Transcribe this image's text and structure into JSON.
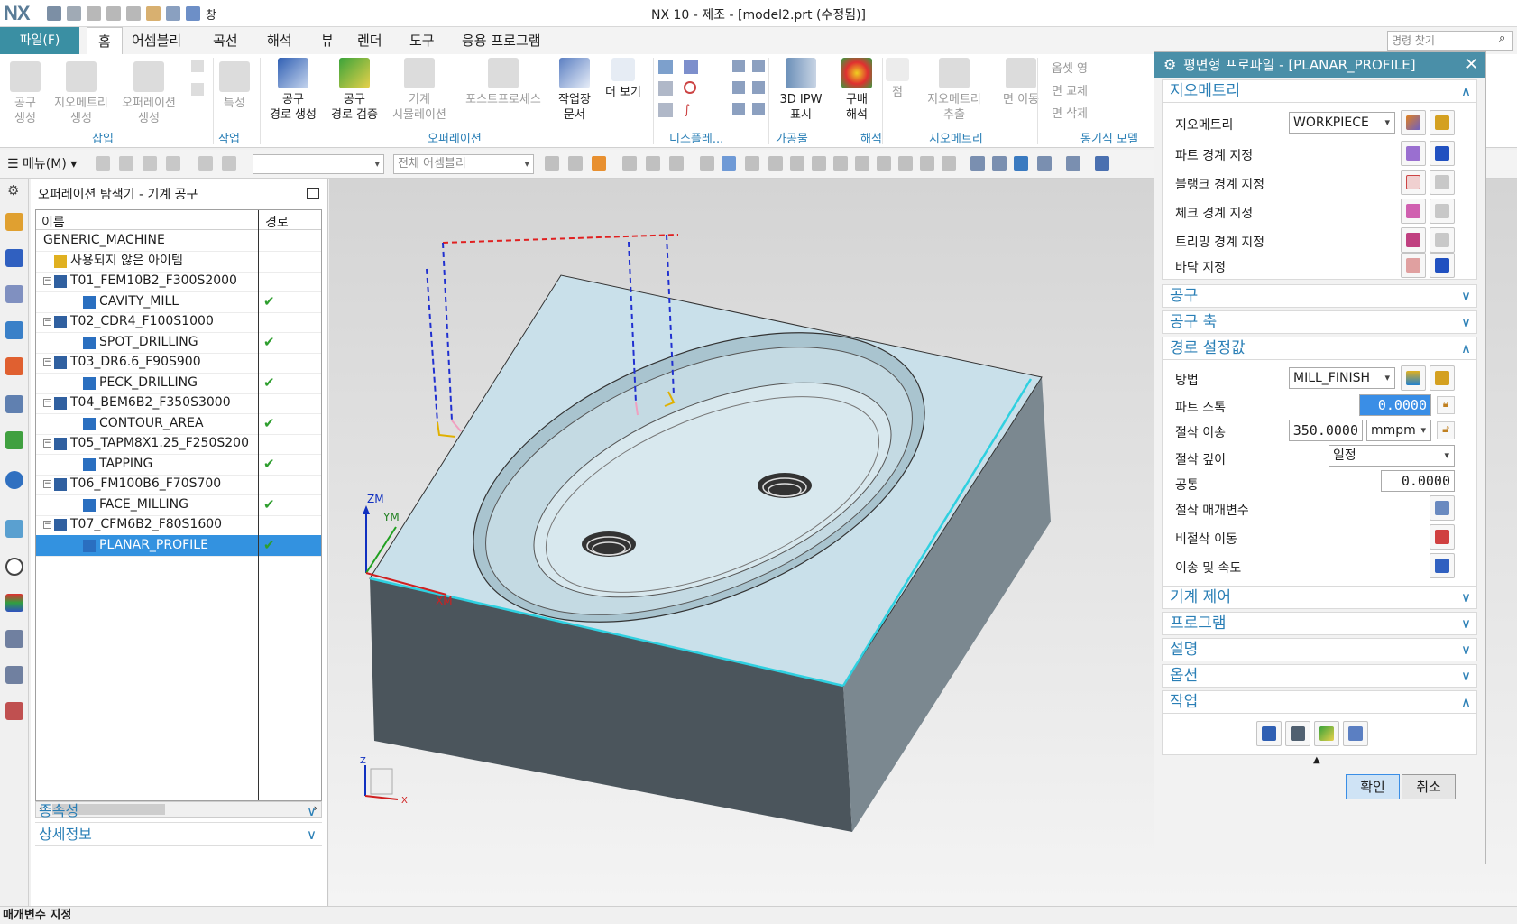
{
  "app": {
    "logo": "NX",
    "title": "NX 10 - 제조 - [model2.prt (수정됨)]",
    "window_menu": "창"
  },
  "menubar": {
    "file": "파일(F)",
    "tabs": [
      "홈",
      "어셈블리",
      "곡선",
      "해석",
      "뷰",
      "렌더",
      "도구",
      "응용 프로그램"
    ],
    "active_tab": "홈",
    "search_placeholder": "명령 찾기"
  },
  "ribbon": {
    "buttons": [
      {
        "label": "공구\n생성",
        "disabled": true
      },
      {
        "label": "지오메트리\n생성",
        "disabled": true
      },
      {
        "label": "오퍼레이션\n생성",
        "disabled": true
      },
      {
        "label": "특성",
        "disabled": true
      },
      {
        "label": "공구\n경로 생성",
        "disabled": false
      },
      {
        "label": "공구\n경로 검증",
        "disabled": false
      },
      {
        "label": "기계\n시뮬레이션",
        "disabled": true
      },
      {
        "label": "포스트프로세스",
        "disabled": true
      },
      {
        "label": "작업장\n문서",
        "disabled": false
      },
      {
        "label": "더 보기",
        "disabled": false
      },
      {
        "label": "3D IPW\n표시",
        "disabled": false
      },
      {
        "label": "구배\n해석",
        "disabled": false
      },
      {
        "label": "점",
        "disabled": true
      },
      {
        "label": "지오메트리\n추출",
        "disabled": true
      },
      {
        "label": "면 이동",
        "disabled": true
      }
    ],
    "small_items": [
      "옵셋 영",
      "면 교체",
      "면 삭제"
    ],
    "groups": [
      "삽입",
      "작업",
      "오퍼레이션",
      "디스플레...",
      "가공물",
      "해석",
      "지오메트리",
      "동기식 모델"
    ]
  },
  "toolbar2": {
    "menu": "메뉴(M)",
    "filter_placeholder": "",
    "assembly_scope": "전체 어셈블리"
  },
  "navigator": {
    "title": "오퍼레이션 탐색기 - 기계 공구",
    "columns": [
      "이름",
      "경로"
    ],
    "rows": [
      {
        "name": "GENERIC_MACHINE",
        "level": 0,
        "type": "machine",
        "check": ""
      },
      {
        "name": "사용되지 않은 아이템",
        "level": 1,
        "type": "folder",
        "check": ""
      },
      {
        "name": "T01_FEM10B2_F300S2000",
        "level": 1,
        "type": "tool",
        "check": ""
      },
      {
        "name": "CAVITY_MILL",
        "level": 2,
        "type": "op",
        "check": "✔"
      },
      {
        "name": "T02_CDR4_F100S1000",
        "level": 1,
        "type": "tool",
        "check": ""
      },
      {
        "name": "SPOT_DRILLING",
        "level": 2,
        "type": "op",
        "check": "✔"
      },
      {
        "name": "T03_DR6.6_F90S900",
        "level": 1,
        "type": "tool",
        "check": ""
      },
      {
        "name": "PECK_DRILLING",
        "level": 2,
        "type": "op",
        "check": "✔"
      },
      {
        "name": "T04_BEM6B2_F350S3000",
        "level": 1,
        "type": "tool",
        "check": ""
      },
      {
        "name": "CONTOUR_AREA",
        "level": 2,
        "type": "op",
        "check": "✔"
      },
      {
        "name": "T05_TAPM8X1.25_F250S200",
        "level": 1,
        "type": "tool",
        "check": ""
      },
      {
        "name": "TAPPING",
        "level": 2,
        "type": "op",
        "check": "✔"
      },
      {
        "name": "T06_FM100B6_F70S700",
        "level": 1,
        "type": "tool",
        "check": ""
      },
      {
        "name": "FACE_MILLING",
        "level": 2,
        "type": "op",
        "check": "✔"
      },
      {
        "name": "T07_CFM6B2_F80S1600",
        "level": 1,
        "type": "tool",
        "check": ""
      },
      {
        "name": "PLANAR_PROFILE",
        "level": 2,
        "type": "op",
        "check": "✔",
        "selected": true
      }
    ],
    "bottom_sections": [
      "종속성",
      "상세정보"
    ]
  },
  "viewport": {
    "axis_labels": [
      "ZM",
      "YM",
      "XM"
    ],
    "triad": [
      "Z",
      "X"
    ]
  },
  "dialog": {
    "title": "평면형 프로파일 - [PLANAR_PROFILE]",
    "geometry": {
      "header": "지오메트리",
      "label": "지오메트리",
      "value": "WORKPIECE",
      "items": [
        "파트 경계 지정",
        "블랭크 경계 지정",
        "체크 경계 지정",
        "트리밍 경계 지정",
        "바닥 지정"
      ]
    },
    "collapsed1": [
      "공구",
      "공구 축"
    ],
    "path": {
      "header": "경로 설정값",
      "method_label": "방법",
      "method_value": "MILL_FINISH",
      "stock_label": "파트 스톡",
      "stock_value": "0.0000",
      "feed_label": "절삭 이송",
      "feed_value": "350.0000",
      "feed_unit": "mmpm",
      "depth_label": "절삭 깊이",
      "depth_value": "일정",
      "common_label": "공통",
      "common_value": "0.0000",
      "cut_param_label": "절삭 매개변수",
      "noncut_label": "비절삭 이동",
      "feeds_label": "이송 및 속도"
    },
    "collapsed2": [
      "기계 제어",
      "프로그램",
      "설명",
      "옵션"
    ],
    "actions_header": "작업",
    "ok": "확인",
    "cancel": "취소"
  },
  "status": "매개변수 지정",
  "colors": {
    "accent": "#2a7fb6",
    "title_bar": "#4a8fa8",
    "selection": "#3392e0",
    "file_tab": "#3a8fa3",
    "check": "#2e9e2e"
  }
}
